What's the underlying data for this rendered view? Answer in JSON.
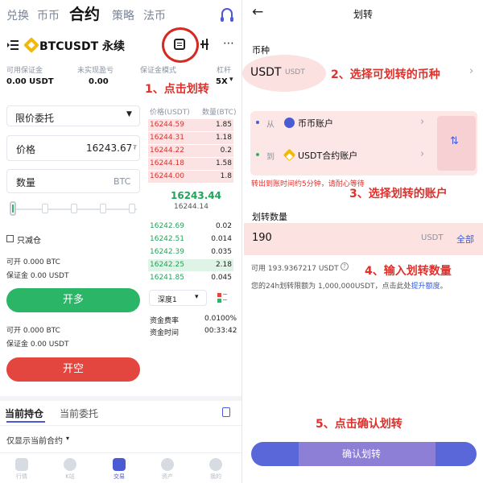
{
  "left": {
    "top_tabs": [
      "兑换",
      "币币",
      "合约",
      "策略",
      "法币"
    ],
    "active_tab": "合约",
    "pair": "BTCUSDT 永续",
    "account_labels": {
      "available_margin": "可用保证金",
      "unrealized_pnl": "未实现盈亏",
      "margin_mode": "保证金模式",
      "leverage": "杠杆"
    },
    "account_values": {
      "available_margin": "0.00 USDT",
      "unrealized_pnl": "0.00",
      "leverage": "5X"
    },
    "annotation1": "1、点击划转",
    "order_type": "限价委托",
    "price_label": "价格",
    "price_value": "16243.67",
    "qty_label": "数量",
    "qty_unit": "BTC",
    "reduce_only": "只减仓",
    "open_available_1": "可开 0.000 BTC",
    "margin_1": "保证金 0.00 USDT",
    "long_button": "开多",
    "open_available_2": "可开 0.000 BTC",
    "margin_2": "保证金 0.00 USDT",
    "short_button": "开空",
    "book_header": {
      "price": "价格(USDT)",
      "qty": "数量(BTC)"
    },
    "asks": [
      {
        "price": "16244.59",
        "qty": "1.85"
      },
      {
        "price": "16244.31",
        "qty": "1.18"
      },
      {
        "price": "16244.22",
        "qty": "0.2"
      },
      {
        "price": "16244.18",
        "qty": "1.58"
      },
      {
        "price": "16244.00",
        "qty": "1.8"
      }
    ],
    "last_price": "16243.44",
    "mark_price": "16244.14",
    "bids": [
      {
        "price": "16242.69",
        "qty": "0.02"
      },
      {
        "price": "16242.51",
        "qty": "0.014"
      },
      {
        "price": "16242.39",
        "qty": "0.035"
      },
      {
        "price": "16242.25",
        "qty": "2.18"
      },
      {
        "price": "16241.85",
        "qty": "0.045"
      }
    ],
    "depth_select": "深度1",
    "funding_rate_label": "资金费率",
    "funding_rate_value": "0.0100%",
    "funding_time_label": "资金时间",
    "funding_time_value": "00:33:42",
    "bottom_tabs": [
      "当前持仓",
      "当前委托"
    ],
    "filter": "仅显示当前合约",
    "nav": [
      "行情",
      "K站",
      "交易",
      "资产",
      "我的"
    ]
  },
  "right": {
    "title": "划转",
    "currency_label": "币种",
    "currency_value": "USDT",
    "currency_sub": "USDT",
    "annotation2": "2、选择可划转的币种",
    "from_label": "从",
    "from_account": "币币账户",
    "to_label": "到",
    "to_account": "USDT合约账户",
    "note": "转出到账时间约5分钟，请耐心等待",
    "annotation3": "3、选择划转的账户",
    "amount_label": "划转数量",
    "amount_value": "190",
    "amount_unit": "USDT",
    "all_button": "全部",
    "available": "可用 193.9367217 USDT",
    "annotation4": "4、输入划转数量",
    "limit_text": "您的24h划转限额为 1,000,000USDT，点击此处",
    "limit_link": "提升额度",
    "annotation5": "5、点击确认划转",
    "confirm_button": "确认划转"
  }
}
